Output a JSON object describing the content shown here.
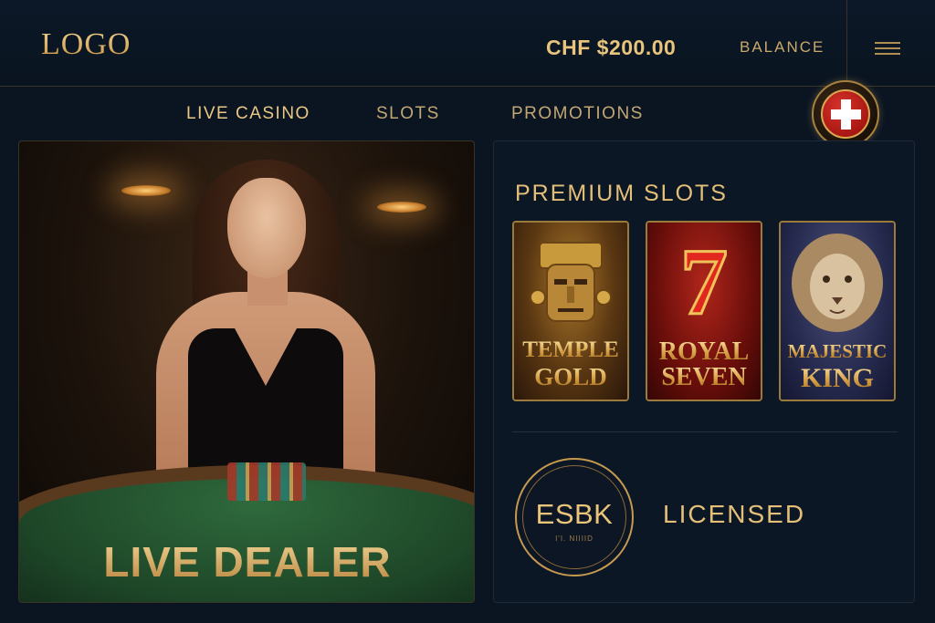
{
  "header": {
    "logo": "LOGO",
    "balance_amount": "CHF $200.00",
    "balance_label": "BALANCE",
    "menu_icon": "hamburger-menu-icon"
  },
  "nav": {
    "items": [
      {
        "label": "LIVE CASINO",
        "active": true
      },
      {
        "label": "SLOTS",
        "active": false
      },
      {
        "label": "PROMOTIONS",
        "active": false
      }
    ],
    "badge_icon": "swiss-cross-icon"
  },
  "live": {
    "title": "LIVE DEALER"
  },
  "slots": {
    "section_title": "PREMIUM SLOTS",
    "games": [
      {
        "line1": "TEMPLE",
        "line2": "GOLD"
      },
      {
        "line1": "ROYAL",
        "line2": "SEVEN",
        "symbol": "7"
      },
      {
        "line1": "MAJESTIC",
        "line2": "KING"
      }
    ]
  },
  "license": {
    "seal_text": "ESBK",
    "seal_sub": "I'I. NIIIID",
    "label": "LICENSED"
  },
  "colors": {
    "background": "#0b1522",
    "gold": "#d8b36a",
    "swiss_red": "#c81e1a"
  }
}
